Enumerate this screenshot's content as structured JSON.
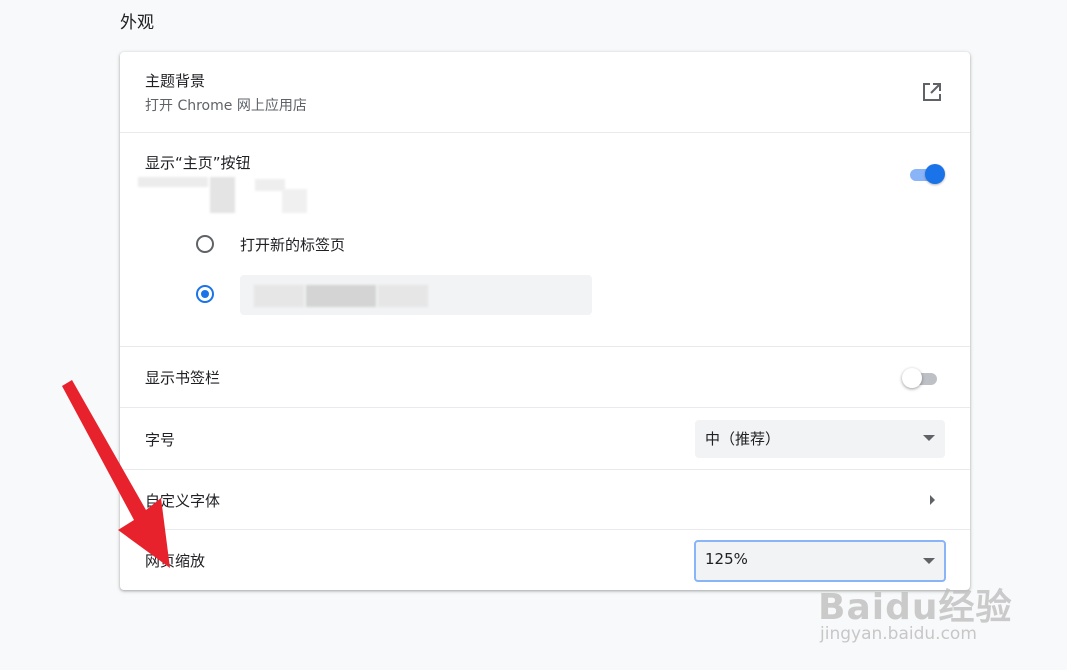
{
  "section": {
    "title": "外观"
  },
  "theme": {
    "label": "主题背景",
    "sublabel": "打开 Chrome 网上应用店",
    "icon": "open-in-new-icon"
  },
  "home_button": {
    "label": "显示“主页”按钮",
    "enabled": true,
    "options": [
      {
        "label": "打开新的标签页",
        "selected": false
      },
      {
        "label": "",
        "selected": true
      }
    ]
  },
  "bookmarks_bar": {
    "label": "显示书签栏",
    "enabled": false
  },
  "font_size": {
    "label": "字号",
    "value": "中（推荐）"
  },
  "custom_fonts": {
    "label": "自定义字体"
  },
  "page_zoom": {
    "label": "网页缩放",
    "value": "125%"
  },
  "watermark": {
    "text": "Baidu经验",
    "sub": "jingyan.baidu.com"
  },
  "colors": {
    "accent": "#1a73e8",
    "arrow": "#e8222d"
  }
}
